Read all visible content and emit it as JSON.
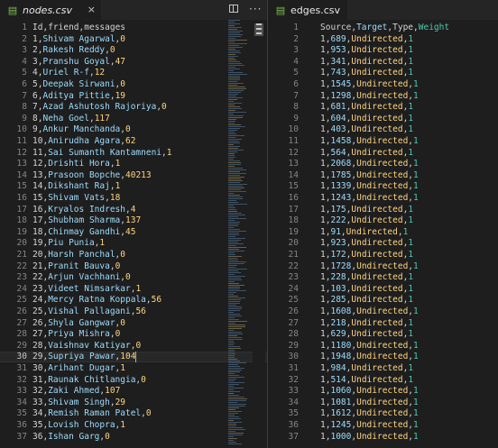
{
  "left": {
    "tab": {
      "icon": "csv-file-icon",
      "label": "nodes.csv",
      "close": "×"
    },
    "actions": {
      "split": "split-editor-icon",
      "more": "···"
    },
    "header": {
      "cols": [
        "Id",
        "friend",
        "messages"
      ]
    },
    "rows": [
      {
        "ln": "2",
        "id": "1",
        "friend": "Shivam Agarwal",
        "msg": "0"
      },
      {
        "ln": "3",
        "id": "2",
        "friend": "Rakesh Reddy",
        "msg": "0"
      },
      {
        "ln": "4",
        "id": "3",
        "friend": "Pranshu Goyal",
        "msg": "47"
      },
      {
        "ln": "5",
        "id": "4",
        "friend": "Uriel R-f",
        "msg": "12"
      },
      {
        "ln": "6",
        "id": "5",
        "friend": "Deepak Sirwani",
        "msg": "0"
      },
      {
        "ln": "7",
        "id": "6",
        "friend": "Aditya Pittie",
        "msg": "19"
      },
      {
        "ln": "8",
        "id": "7",
        "friend": "Azad Ashutosh Rajoriya",
        "msg": "0"
      },
      {
        "ln": "9",
        "id": "8",
        "friend": "Neha Goel",
        "msg": "117"
      },
      {
        "ln": "10",
        "id": "9",
        "friend": "Ankur Manchanda",
        "msg": "0"
      },
      {
        "ln": "11",
        "id": "10",
        "friend": "Anirudha Agara",
        "msg": "62"
      },
      {
        "ln": "12",
        "id": "11",
        "friend": "Sai Sumanth Kantamneni",
        "msg": "1"
      },
      {
        "ln": "13",
        "id": "12",
        "friend": "Drishti Hora",
        "msg": "1"
      },
      {
        "ln": "14",
        "id": "13",
        "friend": "Prasoon Bopche",
        "msg": "40213"
      },
      {
        "ln": "15",
        "id": "14",
        "friend": "Dikshant Raj",
        "msg": "1"
      },
      {
        "ln": "16",
        "id": "15",
        "friend": "Shivam Vats",
        "msg": "18"
      },
      {
        "ln": "17",
        "id": "16",
        "friend": "Kryalos Indresh",
        "msg": "4"
      },
      {
        "ln": "18",
        "id": "17",
        "friend": "Shubham Sharma",
        "msg": "137"
      },
      {
        "ln": "19",
        "id": "18",
        "friend": "Chinmay Gandhi",
        "msg": "45"
      },
      {
        "ln": "20",
        "id": "19",
        "friend": "Piu Punia",
        "msg": "1"
      },
      {
        "ln": "21",
        "id": "20",
        "friend": "Harsh Panchal",
        "msg": "0"
      },
      {
        "ln": "22",
        "id": "21",
        "friend": "Pranit Bauva",
        "msg": "0"
      },
      {
        "ln": "23",
        "id": "22",
        "friend": "Arjun Vachhani",
        "msg": "0"
      },
      {
        "ln": "24",
        "id": "23",
        "friend": "Videet Nimsarkar",
        "msg": "1"
      },
      {
        "ln": "25",
        "id": "24",
        "friend": "Mercy Ratna Koppala",
        "msg": "56"
      },
      {
        "ln": "26",
        "id": "25",
        "friend": "Vishal Pallagani",
        "msg": "56"
      },
      {
        "ln": "27",
        "id": "26",
        "friend": "Shyla Gangwar",
        "msg": "0"
      },
      {
        "ln": "28",
        "id": "27",
        "friend": "Priya Mishra",
        "msg": "0"
      },
      {
        "ln": "29",
        "id": "28",
        "friend": "Vaishnav Katiyar",
        "msg": "0"
      },
      {
        "ln": "30",
        "id": "29",
        "friend": "Supriya Pawar",
        "msg": "104"
      },
      {
        "ln": "31",
        "id": "30",
        "friend": "Arihant Dugar",
        "msg": "1"
      },
      {
        "ln": "32",
        "id": "31",
        "friend": "Raunak Chitlangia",
        "msg": "0"
      },
      {
        "ln": "33",
        "id": "32",
        "friend": "Zaki Ahmed",
        "msg": "107"
      },
      {
        "ln": "34",
        "id": "33",
        "friend": "Shivam Singh",
        "msg": "29"
      },
      {
        "ln": "35",
        "id": "34",
        "friend": "Remish Raman Patel",
        "msg": "0"
      },
      {
        "ln": "36",
        "id": "35",
        "friend": "Lovish Chopra",
        "msg": "1"
      },
      {
        "ln": "37",
        "id": "36",
        "friend": "Ishan Garg",
        "msg": "0"
      }
    ],
    "active_line": "30"
  },
  "right": {
    "tab": {
      "icon": "csv-file-icon",
      "label": "edges.csv"
    },
    "header": {
      "cols": [
        "Source",
        "Target",
        "Type",
        "Weight"
      ]
    },
    "rows": [
      {
        "ln": "2",
        "src": "1",
        "tgt": "689",
        "typ": "Undirected",
        "wt": "1"
      },
      {
        "ln": "3",
        "src": "1",
        "tgt": "953",
        "typ": "Undirected",
        "wt": "1"
      },
      {
        "ln": "4",
        "src": "1",
        "tgt": "341",
        "typ": "Undirected",
        "wt": "1"
      },
      {
        "ln": "5",
        "src": "1",
        "tgt": "743",
        "typ": "Undirected",
        "wt": "1"
      },
      {
        "ln": "6",
        "src": "1",
        "tgt": "1545",
        "typ": "Undirected",
        "wt": "1"
      },
      {
        "ln": "7",
        "src": "1",
        "tgt": "1298",
        "typ": "Undirected",
        "wt": "1"
      },
      {
        "ln": "8",
        "src": "1",
        "tgt": "681",
        "typ": "Undirected",
        "wt": "1"
      },
      {
        "ln": "9",
        "src": "1",
        "tgt": "604",
        "typ": "Undirected",
        "wt": "1"
      },
      {
        "ln": "10",
        "src": "1",
        "tgt": "403",
        "typ": "Undirected",
        "wt": "1"
      },
      {
        "ln": "11",
        "src": "1",
        "tgt": "1458",
        "typ": "Undirected",
        "wt": "1"
      },
      {
        "ln": "12",
        "src": "1",
        "tgt": "564",
        "typ": "Undirected",
        "wt": "1"
      },
      {
        "ln": "13",
        "src": "1",
        "tgt": "2068",
        "typ": "Undirected",
        "wt": "1"
      },
      {
        "ln": "14",
        "src": "1",
        "tgt": "1785",
        "typ": "Undirected",
        "wt": "1"
      },
      {
        "ln": "15",
        "src": "1",
        "tgt": "1339",
        "typ": "Undirected",
        "wt": "1"
      },
      {
        "ln": "16",
        "src": "1",
        "tgt": "1243",
        "typ": "Undirected",
        "wt": "1"
      },
      {
        "ln": "17",
        "src": "1",
        "tgt": "175",
        "typ": "Undirected",
        "wt": "1"
      },
      {
        "ln": "18",
        "src": "1",
        "tgt": "222",
        "typ": "Undirected",
        "wt": "1"
      },
      {
        "ln": "19",
        "src": "1",
        "tgt": "91",
        "typ": "Undirected",
        "wt": "1"
      },
      {
        "ln": "20",
        "src": "1",
        "tgt": "923",
        "typ": "Undirected",
        "wt": "1"
      },
      {
        "ln": "21",
        "src": "1",
        "tgt": "172",
        "typ": "Undirected",
        "wt": "1"
      },
      {
        "ln": "22",
        "src": "1",
        "tgt": "1728",
        "typ": "Undirected",
        "wt": "1"
      },
      {
        "ln": "23",
        "src": "1",
        "tgt": "228",
        "typ": "Undirected",
        "wt": "1"
      },
      {
        "ln": "24",
        "src": "1",
        "tgt": "103",
        "typ": "Undirected",
        "wt": "1"
      },
      {
        "ln": "25",
        "src": "1",
        "tgt": "285",
        "typ": "Undirected",
        "wt": "1"
      },
      {
        "ln": "26",
        "src": "1",
        "tgt": "1608",
        "typ": "Undirected",
        "wt": "1"
      },
      {
        "ln": "27",
        "src": "1",
        "tgt": "218",
        "typ": "Undirected",
        "wt": "1"
      },
      {
        "ln": "28",
        "src": "1",
        "tgt": "629",
        "typ": "Undirected",
        "wt": "1"
      },
      {
        "ln": "29",
        "src": "1",
        "tgt": "1180",
        "typ": "Undirected",
        "wt": "1"
      },
      {
        "ln": "30",
        "src": "1",
        "tgt": "1948",
        "typ": "Undirected",
        "wt": "1"
      },
      {
        "ln": "31",
        "src": "1",
        "tgt": "984",
        "typ": "Undirected",
        "wt": "1"
      },
      {
        "ln": "32",
        "src": "1",
        "tgt": "514",
        "typ": "Undirected",
        "wt": "1"
      },
      {
        "ln": "33",
        "src": "1",
        "tgt": "1060",
        "typ": "Undirected",
        "wt": "1"
      },
      {
        "ln": "34",
        "src": "1",
        "tgt": "1081",
        "typ": "Undirected",
        "wt": "1"
      },
      {
        "ln": "35",
        "src": "1",
        "tgt": "1612",
        "typ": "Undirected",
        "wt": "1"
      },
      {
        "ln": "36",
        "src": "1",
        "tgt": "1245",
        "typ": "Undirected",
        "wt": "1"
      },
      {
        "ln": "37",
        "src": "1",
        "tgt": "1000",
        "typ": "Undirected",
        "wt": "1"
      }
    ]
  }
}
